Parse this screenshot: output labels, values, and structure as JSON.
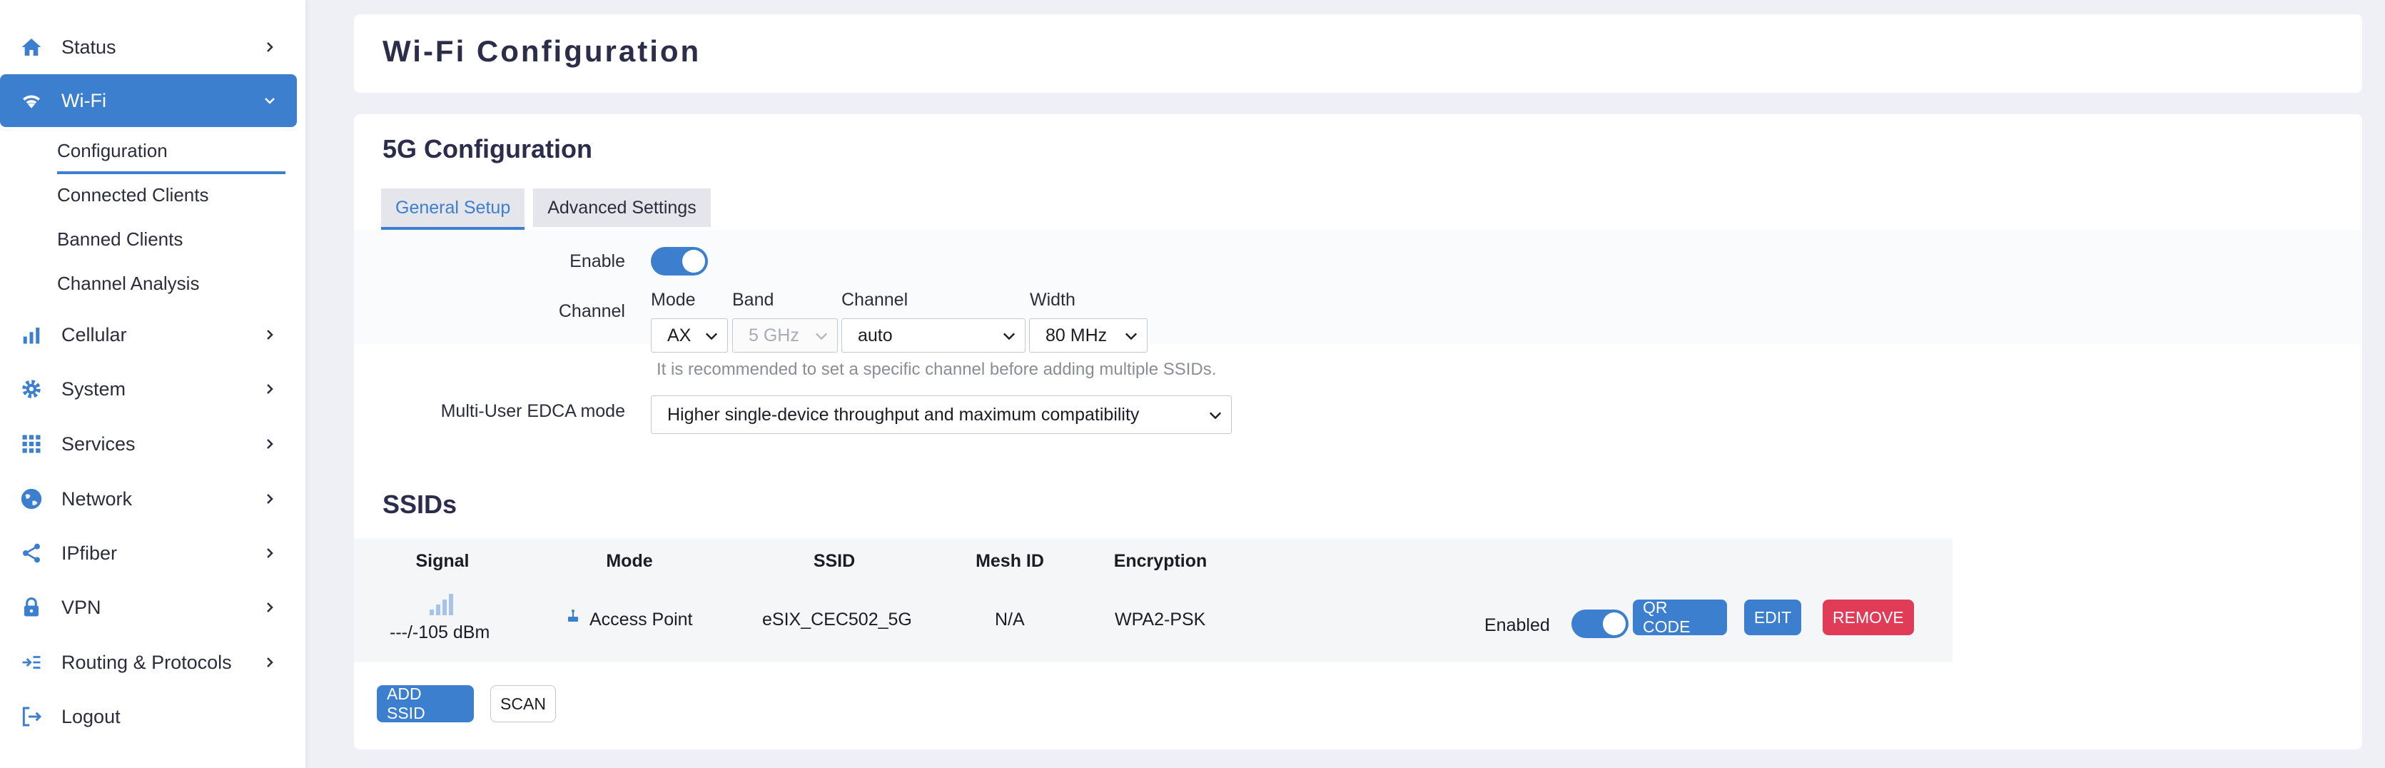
{
  "sidebar": {
    "items": [
      {
        "label": "Status",
        "icon": "home-icon"
      },
      {
        "label": "Wi-Fi",
        "icon": "wifi-icon"
      },
      {
        "label": "Cellular",
        "icon": "signal-bars-icon"
      },
      {
        "label": "System",
        "icon": "gear-icon"
      },
      {
        "label": "Services",
        "icon": "grid-icon"
      },
      {
        "label": "Network",
        "icon": "globe-icon"
      },
      {
        "label": "IPfiber",
        "icon": "share-icon"
      },
      {
        "label": "VPN",
        "icon": "lock-icon"
      },
      {
        "label": "Routing & Protocols",
        "icon": "routing-icon"
      },
      {
        "label": "Logout",
        "icon": "logout-icon"
      }
    ],
    "wifi_subitems": [
      "Configuration",
      "Connected Clients",
      "Banned Clients",
      "Channel Analysis"
    ]
  },
  "page": {
    "title": "Wi-Fi Configuration"
  },
  "config": {
    "section_title": "5G Configuration",
    "tabs": [
      "General Setup",
      "Advanced Settings"
    ],
    "enable_label": "Enable",
    "enabled": true,
    "channel_label": "Channel",
    "mode_label": "Mode",
    "mode_value": "AX",
    "band_label": "Band",
    "band_value": "5 GHz",
    "channel_sub_label": "Channel",
    "channel_value": "auto",
    "width_label": "Width",
    "width_value": "80 MHz",
    "hint": "It is recommended to set a specific channel before adding multiple SSIDs.",
    "edca_label": "Multi-User EDCA mode",
    "edca_value": "Higher single-device throughput and maximum compatibility"
  },
  "ssids": {
    "title": "SSIDs",
    "columns": [
      "Signal",
      "Mode",
      "SSID",
      "Mesh ID",
      "Encryption"
    ],
    "rows": [
      {
        "signal": "---/-105 dBm",
        "mode": "Access Point",
        "ssid": "eSIX_CEC502_5G",
        "mesh_id": "N/A",
        "encryption": "WPA2-PSK",
        "status": "Enabled",
        "enabled": true,
        "qr_label": "QR CODE",
        "edit_label": "EDIT",
        "remove_label": "REMOVE"
      }
    ],
    "add_label": "ADD SSID",
    "scan_label": "SCAN"
  },
  "colors": {
    "accent": "#3c7fce",
    "danger": "#e03b57"
  }
}
